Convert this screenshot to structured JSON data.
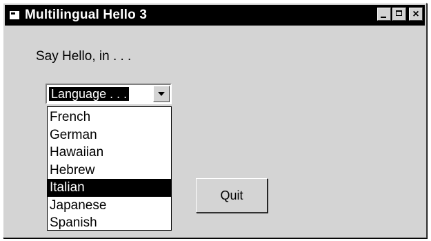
{
  "window": {
    "title": "Multilingual Hello 3",
    "controls": {
      "minimize_icon": "minimize-icon",
      "maximize_icon": "maximize-icon",
      "close_label": "×"
    }
  },
  "main": {
    "prompt": "Say Hello,  in . . .",
    "language_combo": {
      "selected_text": "Language . . .",
      "options": [
        "French",
        "German",
        "Hawaiian",
        "Hebrew",
        "Italian",
        "Japanese",
        "Spanish"
      ],
      "highlighted_option": "Italian"
    },
    "quit_label": "Quit"
  },
  "colors": {
    "face": "#d4d4d4",
    "titlebar": "#000000",
    "highlight": "#000000"
  }
}
